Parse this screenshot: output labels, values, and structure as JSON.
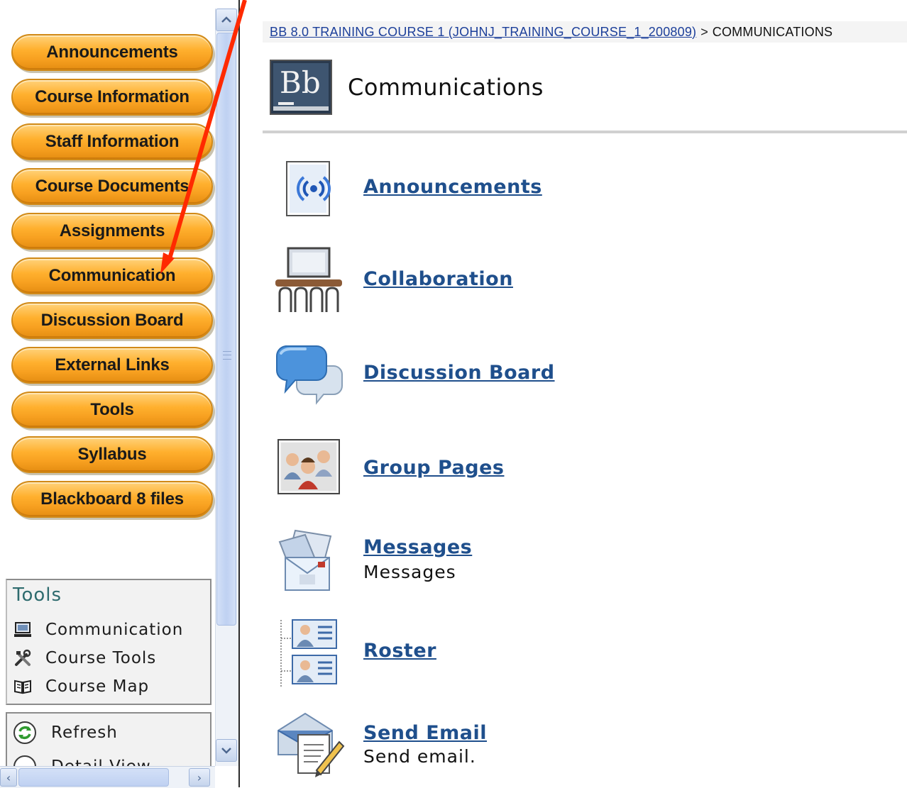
{
  "nav": {
    "menu": [
      {
        "label": "Announcements"
      },
      {
        "label": "Course Information"
      },
      {
        "label": "Staff Information"
      },
      {
        "label": "Course Documents"
      },
      {
        "label": "Assignments"
      },
      {
        "label": "Communication"
      },
      {
        "label": "Discussion Board"
      },
      {
        "label": "External Links"
      },
      {
        "label": "Tools"
      },
      {
        "label": "Syllabus"
      },
      {
        "label": "Blackboard 8 files"
      }
    ],
    "tools_panel": {
      "title": "Tools",
      "items": [
        {
          "label": "Communication",
          "icon": "computer-icon"
        },
        {
          "label": "Course Tools",
          "icon": "wrench-tools-icon"
        },
        {
          "label": "Course Map",
          "icon": "book-map-icon"
        }
      ]
    },
    "refresh_panel": {
      "refresh_label": "Refresh",
      "detail_label": "Detail View"
    },
    "button_color": "#ffb02e",
    "tools_title_color": "#2e6b6e"
  },
  "breadcrumb": {
    "course_link": "BB 8.0 TRAINING COURSE 1 (JOHNJ_TRAINING_COURSE_1_200809)",
    "separator": ">",
    "current": "COMMUNICATIONS"
  },
  "header": {
    "logo_text": "Bb",
    "title": "Communications"
  },
  "tools": [
    {
      "label": "Announcements",
      "description": "",
      "icon": "broadcast-icon"
    },
    {
      "label": "Collaboration",
      "description": "",
      "icon": "classroom-icon"
    },
    {
      "label": "Discussion Board",
      "description": "",
      "icon": "speech-bubbles-icon"
    },
    {
      "label": "Group Pages",
      "description": "",
      "icon": "group-people-icon"
    },
    {
      "label": "Messages",
      "description": "Messages",
      "icon": "envelopes-icon"
    },
    {
      "label": "Roster",
      "description": "",
      "icon": "roster-cards-icon"
    },
    {
      "label": "Send Email",
      "description": "Send email.",
      "icon": "email-pen-icon"
    }
  ],
  "colors": {
    "link": "#1f4f8c",
    "annotation_arrow": "#ff2a00"
  }
}
